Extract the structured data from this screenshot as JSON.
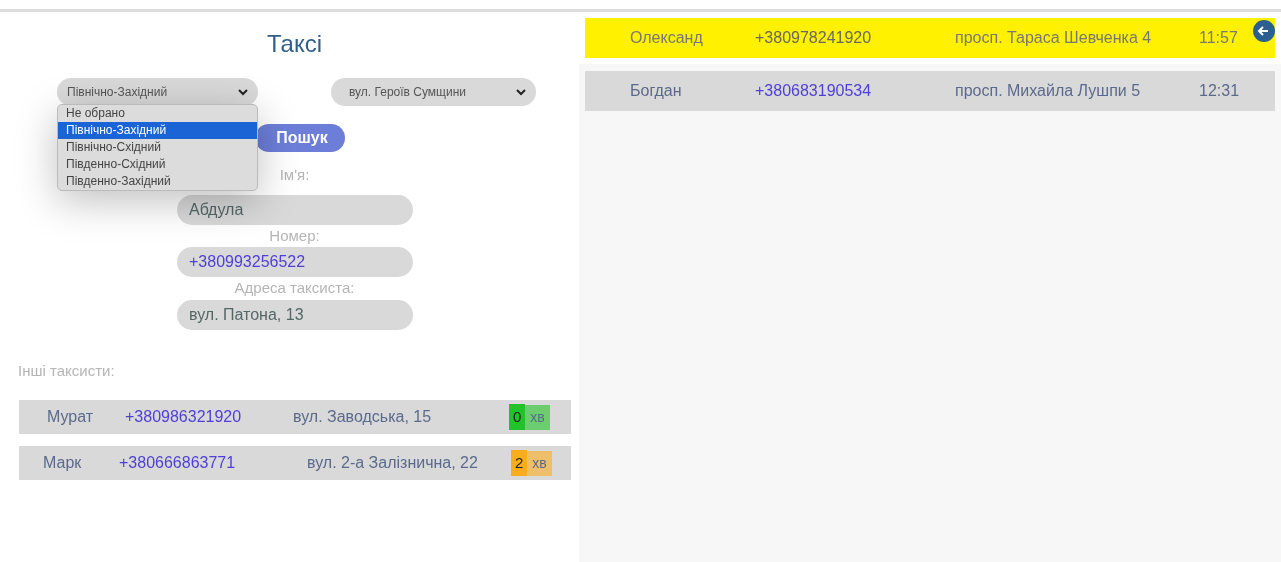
{
  "title": "Таксі",
  "district_select": {
    "value": "Північно-Західний",
    "expanded": true,
    "options": [
      {
        "label": "Не обрано",
        "selected": false
      },
      {
        "label": "Північно-Західний",
        "selected": true
      },
      {
        "label": "Північно-Східний",
        "selected": false
      },
      {
        "label": "Південно-Східний",
        "selected": false
      },
      {
        "label": "Південно-Західний",
        "selected": false
      }
    ]
  },
  "street_select": {
    "value": "вул. Героїв Сумщини"
  },
  "search_button": "Пошук",
  "fields": [
    {
      "label": "Ім'я:",
      "value": "Абдула",
      "kind": "text"
    },
    {
      "label": "Номер:",
      "value": "+380993256522",
      "kind": "phone"
    },
    {
      "label": "Адреса таксиста:",
      "value": "вул. Патона, 13",
      "kind": "text"
    }
  ],
  "others_heading": "Інші таксисти:",
  "other_drivers": [
    {
      "name": "Мурат",
      "phone": "+380986321920",
      "address": "вул. Заводська, 15",
      "minutes": "0",
      "unit": "хв",
      "color": "#22c32a"
    },
    {
      "name": "Марк",
      "phone": "+380666863771",
      "address": "вул. 2-а Залізнична, 22",
      "minutes": "2",
      "unit": "хв",
      "color": "#f9ad1c"
    }
  ],
  "orders": [
    {
      "name": "Олександ",
      "phone": "+380978241920",
      "address": "просп. Тараса Шевченка 4",
      "time": "11:57",
      "selected": true
    },
    {
      "name": "Богдан",
      "phone": "+380683190534",
      "address": "просп. Михайла Лушпи 5",
      "time": "12:31",
      "selected": false
    }
  ]
}
